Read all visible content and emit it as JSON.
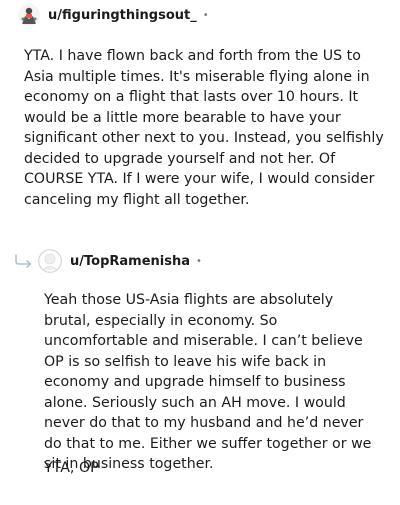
{
  "comment": {
    "author": "u/figuringthingsout_",
    "separator": "•",
    "body": "YTA. I have flown back and forth from the US to Asia multiple times. It's miserable flying alone in economy on a flight that lasts over 10 hours. It would be a little more bearable to have your significant other next to you. Instead, you selfishly decided to upgrade yourself and not her. Of COURSE YTA. If I were your wife, I would consider canceling my flight all together."
  },
  "reply": {
    "author": "u/TopRamenisha",
    "separator": "•",
    "body": "Yeah those US-Asia flights are absolutely brutal, especially in economy. So uncomfortable and miserable. I can’t believe OP is so selfish to leave his wife back in economy and upgrade himself to business alone. Seriously such an AH move. I would never do that to my husband and he’d never do that to me. Either we suffer together or we sit in business together.",
    "signoff": "YTA, OP"
  },
  "colors": {
    "text": "#1c1c1c",
    "muted": "#7c7c7c",
    "reply_arrow": "#a8c4d8"
  },
  "icons": [
    "user-avatar-icon",
    "reply-arrow-icon",
    "user-avatar-default-icon"
  ]
}
